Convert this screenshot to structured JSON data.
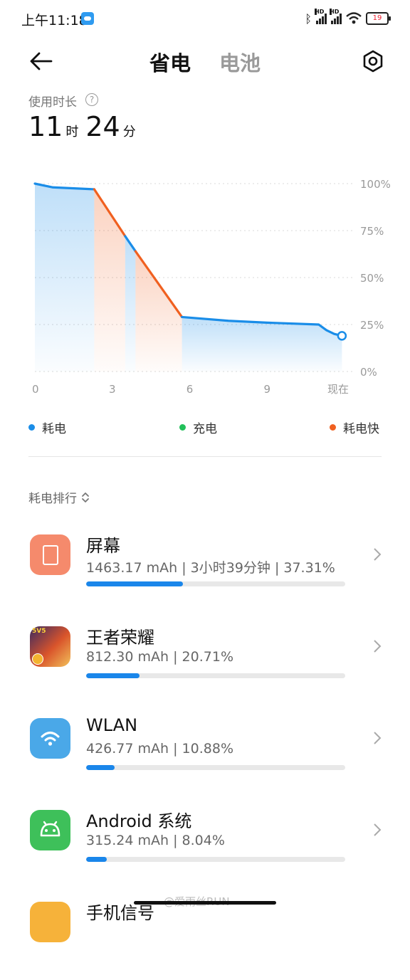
{
  "status_bar": {
    "time": "上午11:18",
    "hd1": "HD",
    "hd2": "HD",
    "battery": "19"
  },
  "header": {
    "tab_active": "省电",
    "tab_inactive": "电池"
  },
  "usage": {
    "label": "使用时长",
    "hours": "11",
    "hours_unit": "时",
    "minutes": "24",
    "minutes_unit": "分",
    "help": "?"
  },
  "chart_data": {
    "type": "line",
    "x_ticks": [
      "0",
      "3",
      "6",
      "9",
      "现在"
    ],
    "y_ticks": [
      "100%",
      "75%",
      "50%",
      "25%",
      "0%"
    ],
    "xlim": [
      0,
      12
    ],
    "ylim": [
      0,
      100
    ],
    "series": [
      {
        "name": "耗电",
        "color": "#1a8de8",
        "points": [
          [
            0,
            100
          ],
          [
            0.7,
            98
          ],
          [
            2.3,
            97
          ]
        ]
      },
      {
        "name": "耗电快",
        "color": "#f06020",
        "points": [
          [
            2.3,
            97
          ],
          [
            3.5,
            72
          ]
        ]
      },
      {
        "name": "耗电",
        "color": "#1a8de8",
        "points": [
          [
            3.5,
            72
          ],
          [
            3.9,
            64
          ]
        ]
      },
      {
        "name": "耗电快",
        "color": "#f06020",
        "points": [
          [
            3.9,
            64
          ],
          [
            5.7,
            29
          ]
        ]
      },
      {
        "name": "耗电",
        "color": "#1a8de8",
        "points": [
          [
            5.7,
            29
          ],
          [
            7.5,
            27
          ],
          [
            9,
            26
          ],
          [
            11,
            25
          ],
          [
            11.3,
            22
          ],
          [
            11.6,
            20
          ],
          [
            11.9,
            19
          ]
        ]
      }
    ]
  },
  "legend": [
    {
      "label": "耗电",
      "color": "#1a8de8"
    },
    {
      "label": "充电",
      "color": "#22c05a"
    },
    {
      "label": "耗电快",
      "color": "#f06020"
    }
  ],
  "ranking": {
    "label": "耗电排行",
    "items": [
      {
        "name": "屏幕",
        "detail": "1463.17 mAh | 3小时39分钟 | 37.31%",
        "percent": 37.31,
        "icon": "screen-icon",
        "icon_color": "#f58a6c"
      },
      {
        "name": "王者荣耀",
        "detail": "812.30 mAh | 20.71%",
        "percent": 20.71,
        "icon": "game-icon",
        "icon_color": "#d9542b"
      },
      {
        "name": "WLAN",
        "detail": "426.77 mAh | 10.88%",
        "percent": 10.88,
        "icon": "wifi-icon",
        "icon_color": "#4aa8e8"
      },
      {
        "name": "Android 系统",
        "detail": "315.24 mAh | 8.04%",
        "percent": 8.04,
        "icon": "android-icon",
        "icon_color": "#3ec05a"
      },
      {
        "name": "手机信号",
        "detail": "",
        "percent": 0,
        "icon": "signal-icon",
        "icon_color": "#f6b23a"
      }
    ]
  },
  "watermark": "@爱雨丝RUN"
}
